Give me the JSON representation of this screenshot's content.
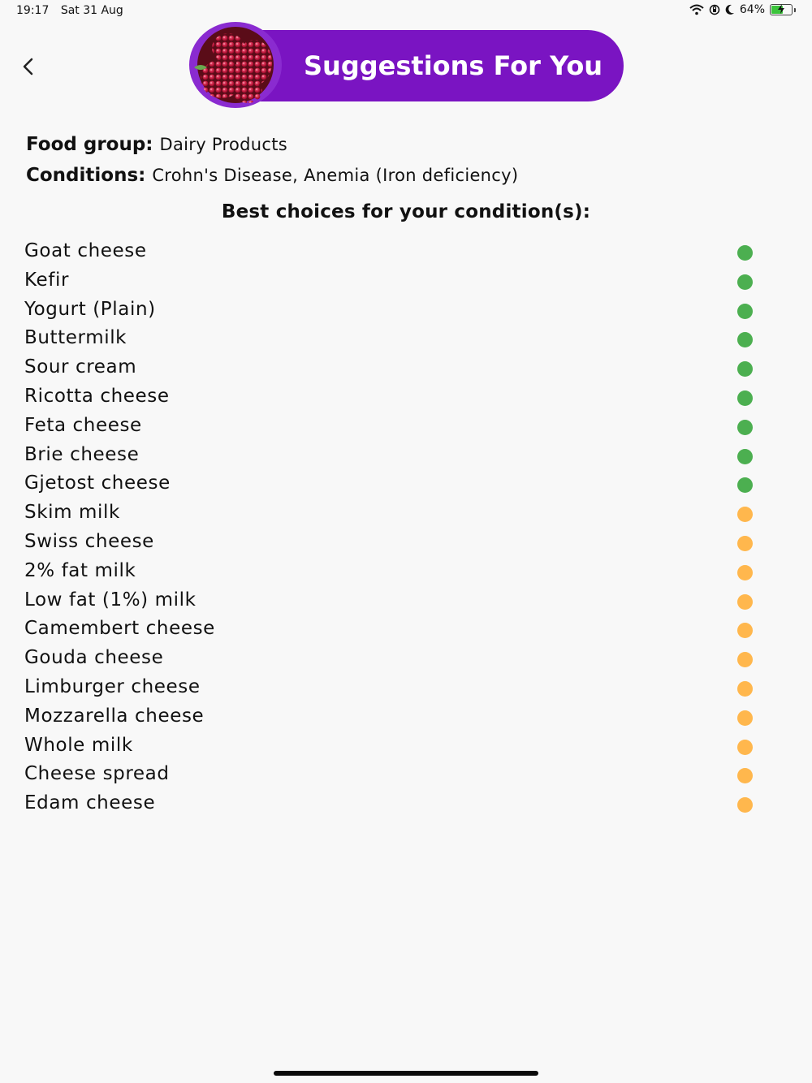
{
  "status_bar": {
    "time": "19:17",
    "date": "Sat 31 Aug",
    "battery_percent": "64%",
    "battery_level": 0.64,
    "icons": [
      "wifi-icon",
      "orientation-lock-icon",
      "moon-icon",
      "battery-icon"
    ]
  },
  "header": {
    "title": "Suggestions For You",
    "back_icon": "chevron-left-icon",
    "image": "raspberry-image",
    "colors": {
      "pill": "#7a14c2",
      "title_text": "#ffffff"
    }
  },
  "info": {
    "food_group_label": "Food group:",
    "food_group_value": "Dairy Products",
    "conditions_label": "Conditions:",
    "conditions_value": "Crohn's Disease, Anemia (Iron deficiency)"
  },
  "section_heading": "Best choices for your condition(s):",
  "status_colors": {
    "best": "#4caf50",
    "moderate": "#ffb74d"
  },
  "foods": [
    {
      "name": "Goat cheese",
      "status": "best"
    },
    {
      "name": "Kefir",
      "status": "best"
    },
    {
      "name": "Yogurt (Plain)",
      "status": "best"
    },
    {
      "name": "Buttermilk",
      "status": "best"
    },
    {
      "name": "Sour cream",
      "status": "best"
    },
    {
      "name": "Ricotta cheese",
      "status": "best"
    },
    {
      "name": "Feta cheese",
      "status": "best"
    },
    {
      "name": "Brie cheese",
      "status": "best"
    },
    {
      "name": "Gjetost cheese",
      "status": "best"
    },
    {
      "name": "Skim milk",
      "status": "moderate"
    },
    {
      "name": "Swiss cheese",
      "status": "moderate"
    },
    {
      "name": "2% fat milk",
      "status": "moderate"
    },
    {
      "name": "Low fat (1%) milk",
      "status": "moderate"
    },
    {
      "name": "Camembert cheese",
      "status": "moderate"
    },
    {
      "name": "Gouda cheese",
      "status": "moderate"
    },
    {
      "name": "Limburger cheese",
      "status": "moderate"
    },
    {
      "name": "Mozzarella cheese",
      "status": "moderate"
    },
    {
      "name": "Whole milk",
      "status": "moderate"
    },
    {
      "name": "Cheese spread",
      "status": "moderate"
    },
    {
      "name": "Edam cheese",
      "status": "moderate"
    }
  ]
}
